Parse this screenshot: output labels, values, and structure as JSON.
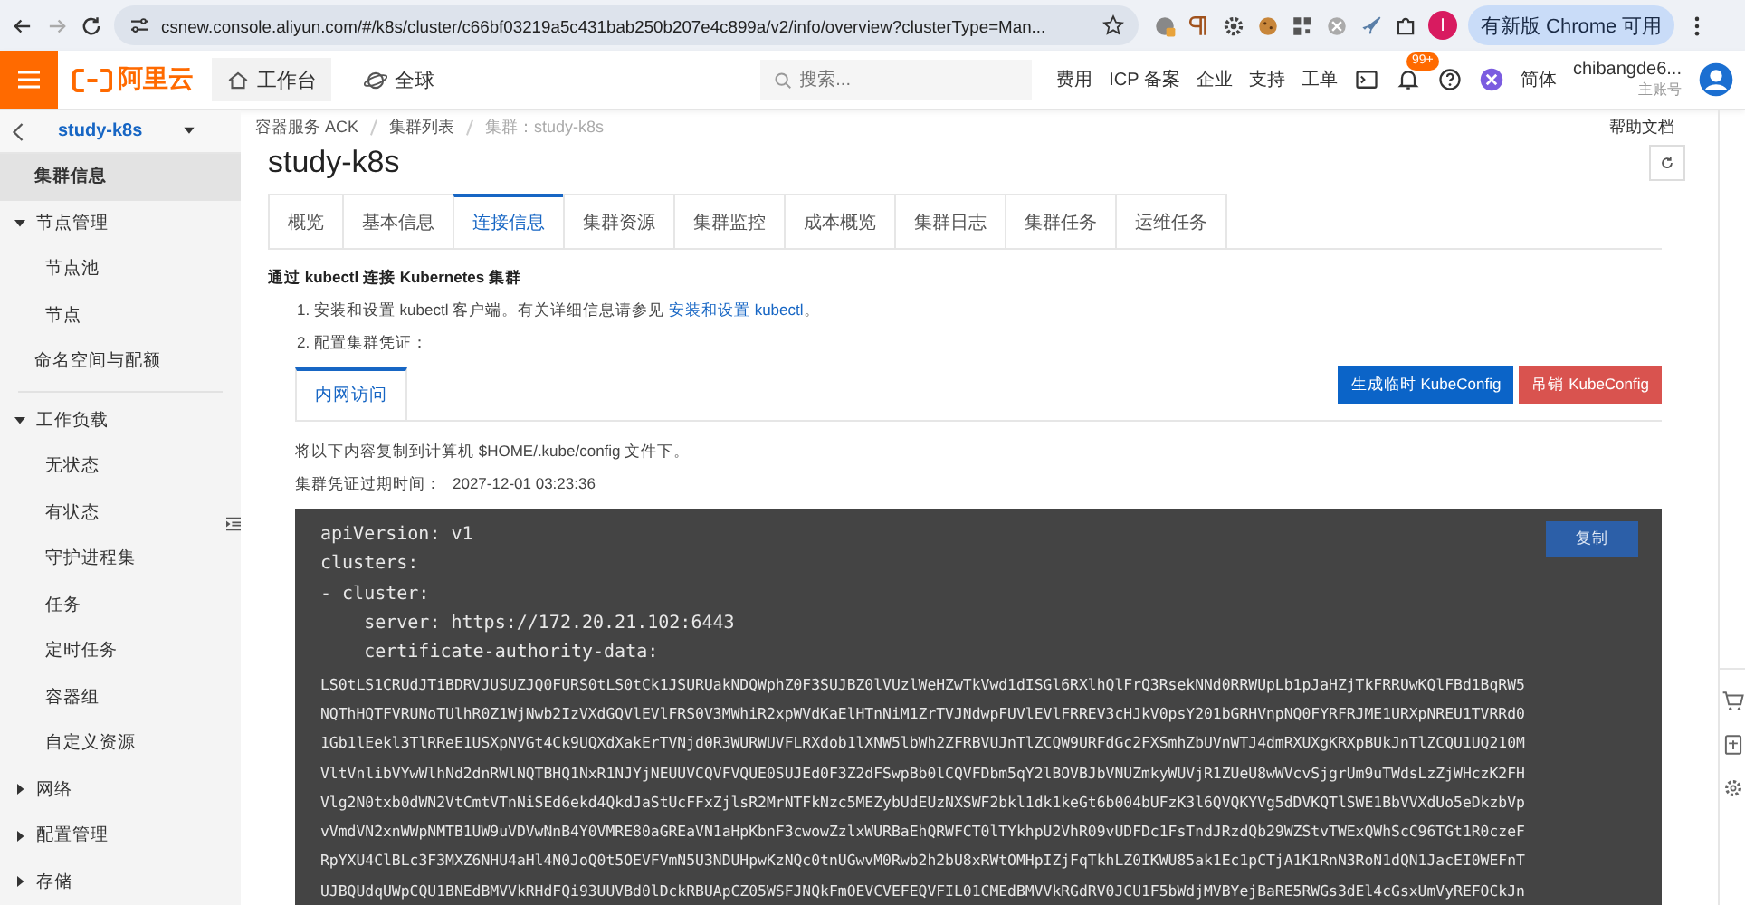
{
  "browser": {
    "url": "csnew.console.aliyun.com/#/k8s/cluster/c66bf03219a5c431bab250b207e4c899a/v2/info/overview?clusterType=Man...",
    "profile": "I",
    "update_label": "有新版 Chrome 可用"
  },
  "header": {
    "logo": "阿里云",
    "workbench": "工作台",
    "region": "全球",
    "search_placeholder": "搜索...",
    "links": [
      "费用",
      "ICP 备案",
      "企业",
      "支持",
      "工单"
    ],
    "badge": "99+",
    "language": "简体",
    "user": "chibangde6...",
    "account_type": "主账号"
  },
  "subheader": {
    "cluster": "study-k8s",
    "breadcrumbs": [
      {
        "label": "容器服务 ACK",
        "current": false
      },
      {
        "label": "集群列表",
        "current": false
      },
      {
        "label": "集群：study-k8s",
        "current": true
      }
    ],
    "help": "帮助文档"
  },
  "sidebar": {
    "items": [
      {
        "label": "集群信息",
        "kind": "item",
        "selected": true
      },
      {
        "label": "节点管理",
        "kind": "group",
        "expanded": true,
        "children": [
          {
            "label": "节点池",
            "kind": "item",
            "selected": false
          },
          {
            "label": "节点",
            "kind": "item",
            "selected": false
          }
        ]
      },
      {
        "label": "命名空间与配额",
        "kind": "item",
        "selected": false
      },
      {
        "label": "工作负载",
        "kind": "group",
        "expanded": true,
        "separator": true,
        "children": [
          {
            "label": "无状态",
            "kind": "item",
            "selected": false
          },
          {
            "label": "有状态",
            "kind": "item",
            "selected": false
          },
          {
            "label": "守护进程集",
            "kind": "item",
            "selected": false
          },
          {
            "label": "任务",
            "kind": "item",
            "selected": false
          },
          {
            "label": "定时任务",
            "kind": "item",
            "selected": false
          },
          {
            "label": "容器组",
            "kind": "item",
            "selected": false
          },
          {
            "label": "自定义资源",
            "kind": "item",
            "selected": false
          }
        ]
      },
      {
        "label": "网络",
        "kind": "group",
        "expanded": false
      },
      {
        "label": "配置管理",
        "kind": "group",
        "expanded": false
      },
      {
        "label": "存储",
        "kind": "group",
        "expanded": false
      }
    ]
  },
  "page": {
    "title": "study-k8s",
    "tabs": [
      {
        "label": "概览",
        "selected": false
      },
      {
        "label": "基本信息",
        "selected": false
      },
      {
        "label": "连接信息",
        "selected": true
      },
      {
        "label": "集群资源",
        "selected": false
      },
      {
        "label": "集群监控",
        "selected": false
      },
      {
        "label": "成本概览",
        "selected": false
      },
      {
        "label": "集群日志",
        "selected": false
      },
      {
        "label": "集群任务",
        "selected": false
      },
      {
        "label": "运维任务",
        "selected": false
      }
    ],
    "section_title": "通过 kubectl 连接 Kubernetes 集群",
    "step_1": "1. 安装和设置 kubectl 客户端。有关详细信息请参见 ",
    "step_1_link": "安装和设置 kubectl",
    "step_1_end": "。",
    "step_2": "2. 配置集群凭证：",
    "sub_tabs": [
      {
        "label": "内网访问",
        "selected": true
      }
    ],
    "buttons": [
      {
        "label": "生成临时 KubeConfig",
        "kind": "primary"
      },
      {
        "label": "吊销 KubeConfig",
        "kind": "danger"
      }
    ],
    "copy_hint": "将以下内容复制到计算机 $HOME/.kube/config 文件下。",
    "expiry_label": "集群凭证过期时间：",
    "expiry": "2027-12-01 03:23:36",
    "copy_button": "复制",
    "code_lines": [
      "apiVersion: v1",
      "clusters:",
      "- cluster:",
      "    server: https://172.20.21.102:6443",
      "    certificate-authority-data:",
      "LS0tLS1CRUdJTiBDRVJUSUZJQ0FURS0tLS0tCk1JSURUakNDQWphZ0F3SUJBZ0lVUzlWeHZwTkVwd1dISGl6RXlhQlFrQ3RsekNNd0RRWUpLb1pJaHZjTkFRRUwKQlFBd1BqRW5",
      "NQThHQTFVRUNoTUlhR0Z1WjNwb2IzVXdGQVlEVlFRS0V3MWhiR2xpWVdKaElHTnNiM1ZrTVJNdwpFUVlEVlFRREV3cHJkV0psY201bGRHVnpNQ0FYRFRJME1URXpNREU1TVRRd0",
      "1Gb1lEekl3TlRReE1USXpNVGt4Ck9UQXdXakErTVNjd0R3WURWUVFLRXdob1lXNW5lbWh2ZFRBVUJnTlZCQW9URFdGc2FXSmhZbUVnWTJ4dmRXUXgKRXpBUkJnTlZCQU1UQ210M",
      "VltVnlibVYwWlhNd2dnRWlNQTBHQ1NxR1NJYjNEUUVCQVFVQUE0SUJEd0F3Z2dFSwpBb0lCQVFDbm5qY2lBOVBJbVNUZmkyWUVjR1ZUeU8wWVcvSjgrUm9uTWdsLzZjWHczK2FH",
      "Vlg2N0txb0dWN2VtCmtVTnNiSEd6ekd4QkdJaStUcFFxZjlsR2MrNTFkNzc5MEZybUdEUzNXSWF2bkl1dk1keGt6b004bUFzK3l6QVQKYVg5dDVKQTlSWE1BbVVXdUo5eDkzbVp",
      "vVmdVN2xnWWpNMTB1UW9uVDVwNnB4Y0VMRE80aGREaVN1aHpKbnF3cwowZzlxWURBaEhQRWFCT0lTYkhpU2VhR09vUDFDc1FsTndJRzdQb29WZStvTWExQWhScC96TGt1R0czeF",
      "RpYXU4ClBLc3F3MXZ6NHU4aHl4N0JoQ0t5OEVFVmN5U3NDUHpwKzNQc0tnUGwvM0Rwb2h2bU8xRWtOMHpIZjFqTkhLZ0IKWU85ak1Ec1pCTjA1K1RnN3RoN1dQN1JacEI0WEFnT",
      "UJBQUdqUWpCQU1BNEdBMVVkRHdFQi93UUVBd0lDckRBUApCZ05WSFJNQkFmOEVCVEFEQVFIL01CMEdBMVVkRGdRV0JCU1F5bWdjMVBYejBaRE5RWGs3dEl4cGsxUmVyREFOCkJn"
    ]
  }
}
